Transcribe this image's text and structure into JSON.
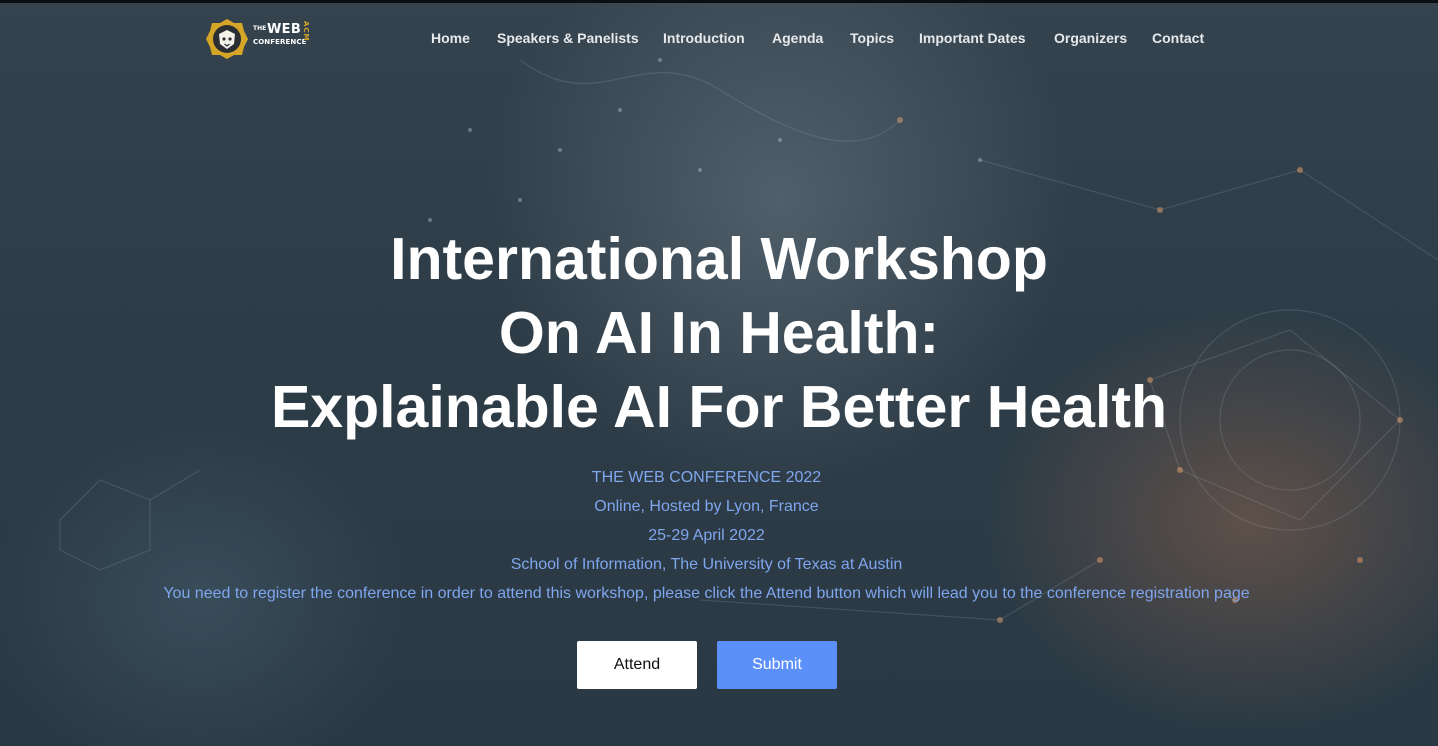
{
  "logo": {
    "the": "THE",
    "web": "WEB",
    "conference": "CONFERENCE",
    "acm": "ACM"
  },
  "nav": {
    "items": [
      {
        "label": "Home"
      },
      {
        "label": "Speakers & Panelists"
      },
      {
        "label": "Introduction"
      },
      {
        "label": "Agenda"
      },
      {
        "label": "Topics"
      },
      {
        "label": "Important Dates"
      },
      {
        "label": "Organizers"
      },
      {
        "label": "Contact"
      }
    ]
  },
  "hero": {
    "title_lines": [
      "International Workshop",
      "On AI In Health:",
      "Explainable AI For Better Health"
    ],
    "info_lines": [
      "THE WEB CONFERENCE 2022",
      "Online, Hosted by Lyon, France",
      "25-29 April 2022",
      "School of Information, The University of Texas at Austin",
      "You need to register the conference in order to attend this workshop, please click the Attend button which will lead you to the conference registration page"
    ],
    "attend_label": "Attend",
    "submit_label": "Submit"
  },
  "colors": {
    "info_text": "#7fa6ee",
    "submit_button": "#5b8ff9",
    "logo_gold": "#d4a526"
  }
}
